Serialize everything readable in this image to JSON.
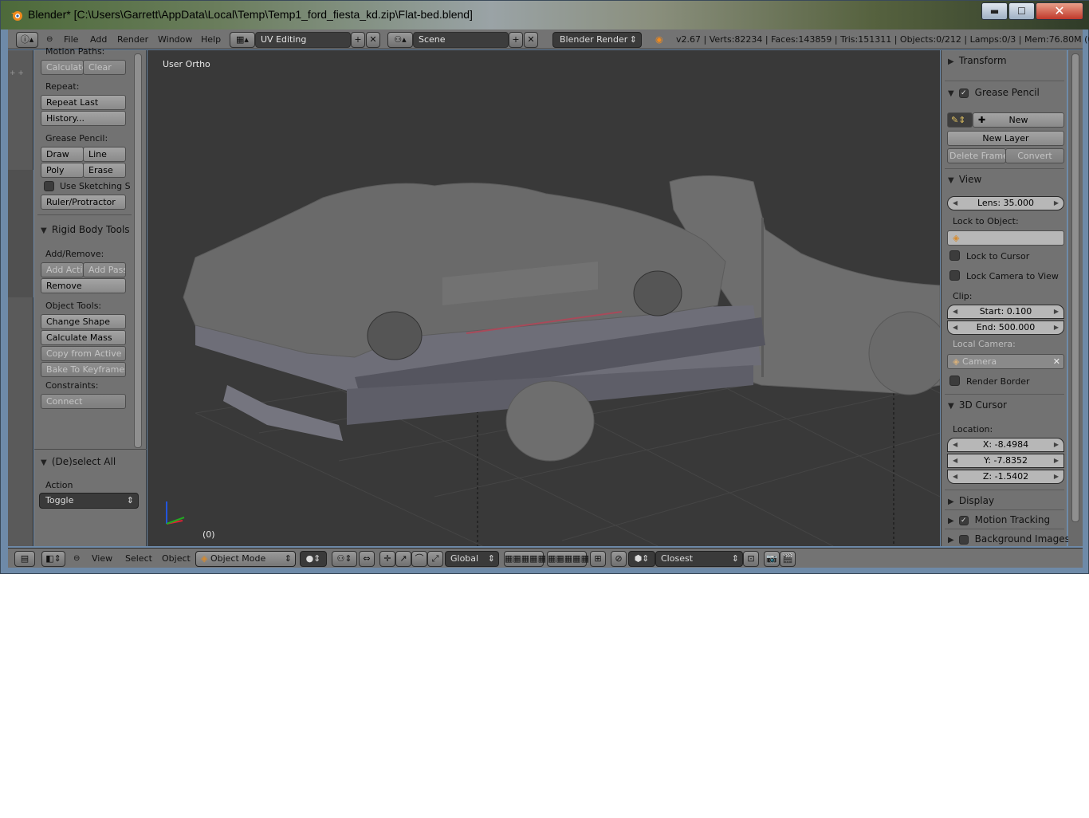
{
  "window": {
    "title": "Blender* [C:\\Users\\Garrett\\AppData\\Local\\Temp\\Temp1_ford_fiesta_kd.zip\\Flat-bed.blend]",
    "minimize": "▬",
    "maximize": "☐",
    "close": "✕"
  },
  "info_header": {
    "menus": [
      "File",
      "Add",
      "Render",
      "Window",
      "Help"
    ],
    "layout": "UV Editing",
    "scene": "Scene",
    "engine": "Blender Render",
    "stats": "v2.67 | Verts:82234 | Faces:143859 | Tris:151311 | Objects:0/212 | Lamps:0/3 | Mem:76.80M (0.11"
  },
  "toolshelf": {
    "motion_paths_label": "Motion Paths:",
    "calculate": "Calculate",
    "clear": "Clear",
    "repeat_label": "Repeat:",
    "repeat_last": "Repeat Last",
    "history": "History...",
    "grease_pencil_label": "Grease Pencil:",
    "draw": "Draw",
    "line": "Line",
    "poly": "Poly",
    "erase": "Erase",
    "use_sketching": "Use Sketching S",
    "ruler": "Ruler/Protractor",
    "rigid_body_title": "Rigid Body Tools",
    "add_remove_label": "Add/Remove:",
    "add_active": "Add Acti",
    "add_passive": "Add Passi",
    "remove": "Remove",
    "object_tools_label": "Object Tools:",
    "change_shape": "Change Shape",
    "calculate_mass": "Calculate Mass",
    "copy_from_active": "Copy from Active",
    "bake_to_keyframes": "Bake To Keyframes",
    "constraints_label": "Constraints:",
    "connect": "Connect",
    "deselect_title": "(De)select All",
    "action_label": "Action",
    "action_value": "Toggle"
  },
  "viewport": {
    "view_name": "User Ortho",
    "frame": "(0)"
  },
  "properties": {
    "transform_title": "Transform",
    "grease_pencil_title": "Grease Pencil",
    "new": "New",
    "new_layer": "New Layer",
    "delete_frame": "Delete Frame",
    "convert": "Convert",
    "view_title": "View",
    "lens": "Lens: 35.000",
    "lock_to_object_label": "Lock to Object:",
    "lock_to_cursor": "Lock to Cursor",
    "lock_camera_to_view": "Lock Camera to View",
    "clip_label": "Clip:",
    "clip_start": "Start: 0.100",
    "clip_end": "End: 500.000",
    "local_camera_label": "Local Camera:",
    "camera": "Camera",
    "render_border": "Render Border",
    "cursor_title": "3D Cursor",
    "location_label": "Location:",
    "x": "X: -8.4984",
    "y": "Y: -7.8352",
    "z": "Z: -1.5402",
    "display_title": "Display",
    "motion_tracking_title": "Motion Tracking",
    "background_images_title": "Background Images"
  },
  "bottom_header": {
    "menus": [
      "View",
      "Select",
      "Object"
    ],
    "mode": "Object Mode",
    "orientation": "Global",
    "snap": "Closest"
  },
  "colors": {
    "panel_bg": "#727272",
    "viewport_bg": "#393939",
    "accent": "#f08a1d"
  }
}
